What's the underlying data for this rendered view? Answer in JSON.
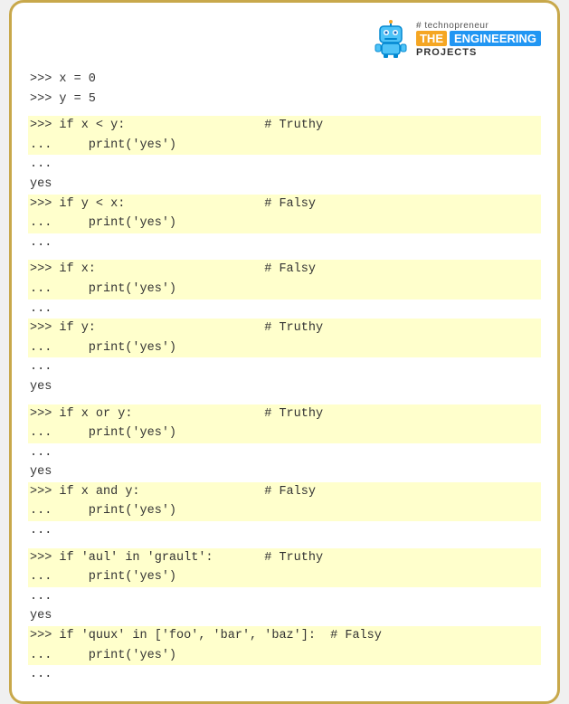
{
  "logo": {
    "techno_label": "# technopreneur",
    "the_label": "THE",
    "engineering_label": "ENGINEERING",
    "projects_label": "PROJECTS"
  },
  "code_blocks": [
    {
      "type": "plain",
      "text": ">>> x = 0"
    },
    {
      "type": "plain",
      "text": ">>> y = 5"
    },
    {
      "type": "blank"
    },
    {
      "type": "highlight",
      "text": ">>> if x < y:                   # Truthy"
    },
    {
      "type": "highlight",
      "text": "...     print('yes')"
    },
    {
      "type": "plain",
      "text": "..."
    },
    {
      "type": "plain",
      "text": "yes"
    },
    {
      "type": "highlight",
      "text": ">>> if y < x:                   # Falsy"
    },
    {
      "type": "highlight",
      "text": "...     print('yes')"
    },
    {
      "type": "plain",
      "text": "..."
    },
    {
      "type": "blank"
    },
    {
      "type": "highlight",
      "text": ">>> if x:                       # Falsy"
    },
    {
      "type": "highlight",
      "text": "...     print('yes')"
    },
    {
      "type": "plain",
      "text": "..."
    },
    {
      "type": "highlight",
      "text": ">>> if y:                       # Truthy"
    },
    {
      "type": "highlight",
      "text": "...     print('yes')"
    },
    {
      "type": "plain",
      "text": "..."
    },
    {
      "type": "plain",
      "text": "yes"
    },
    {
      "type": "blank"
    },
    {
      "type": "highlight",
      "text": ">>> if x or y:                  # Truthy"
    },
    {
      "type": "highlight",
      "text": "...     print('yes')"
    },
    {
      "type": "plain",
      "text": "..."
    },
    {
      "type": "plain",
      "text": "yes"
    },
    {
      "type": "highlight",
      "text": ">>> if x and y:                 # Falsy"
    },
    {
      "type": "highlight",
      "text": "...     print('yes')"
    },
    {
      "type": "plain",
      "text": "..."
    },
    {
      "type": "blank"
    },
    {
      "type": "highlight",
      "text": ">>> if 'aul' in 'grault':       # Truthy"
    },
    {
      "type": "highlight",
      "text": "...     print('yes')"
    },
    {
      "type": "plain",
      "text": "..."
    },
    {
      "type": "plain",
      "text": "yes"
    },
    {
      "type": "highlight",
      "text": ">>> if 'quux' in ['foo', 'bar', 'baz']:  # Falsy"
    },
    {
      "type": "highlight",
      "text": "...     print('yes')"
    },
    {
      "type": "plain",
      "text": "..."
    }
  ]
}
